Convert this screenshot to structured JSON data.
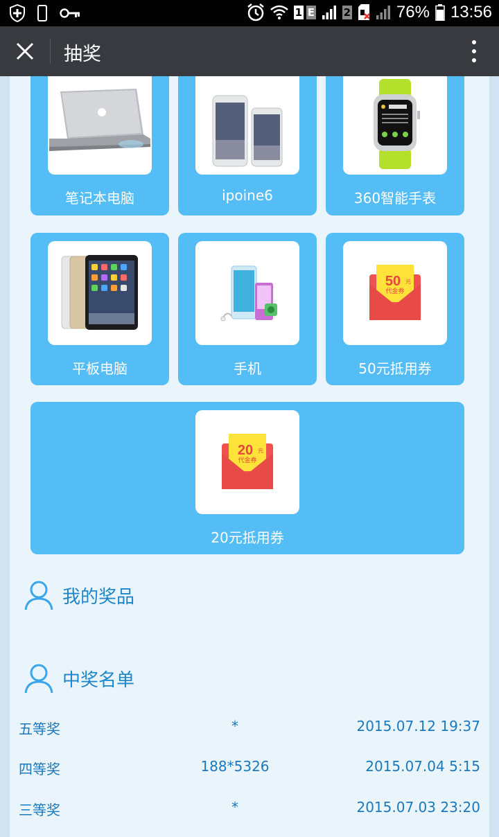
{
  "status_bar": {
    "battery_percent": "76%",
    "time": "13:56",
    "sim1": "1",
    "network": "E",
    "sim2": "2",
    "icons": [
      "shield-plus-icon",
      "phone-outline-icon",
      "key-icon",
      "alarm-icon",
      "wifi-icon",
      "signal-icon",
      "sim-card-icon",
      "signal-icon",
      "battery-icon"
    ]
  },
  "title_bar": {
    "title": "抽奖",
    "close_icon": "close-icon",
    "more_icon": "more-vertical-icon"
  },
  "prizes": [
    {
      "label": "笔记本电脑",
      "image": "laptop"
    },
    {
      "label": "ipoine6",
      "image": "phones"
    },
    {
      "label": "360智能手表",
      "image": "smartwatch"
    },
    {
      "label": "平板电脑",
      "image": "tablets"
    },
    {
      "label": "手机",
      "image": "music-players"
    },
    {
      "label": "50元抵用券",
      "image": "voucher",
      "voucher_value": "50",
      "voucher_unit": "元",
      "voucher_text": "代金券"
    },
    {
      "label": "20元抵用券",
      "image": "voucher",
      "voucher_value": "20",
      "voucher_unit": "元",
      "voucher_text": "代金券"
    }
  ],
  "sections": {
    "my_prizes": "我的奖品",
    "winners": "中奖名单"
  },
  "winners": [
    {
      "prize": "五等奖",
      "user": "*",
      "time": "2015.07.12 19:37"
    },
    {
      "prize": "四等奖",
      "user": "188*5326",
      "time": "2015.07.04 5:15"
    },
    {
      "prize": "三等奖",
      "user": "*",
      "time": "2015.07.03 23:20"
    }
  ],
  "colors": {
    "card_blue": "#55bdf6",
    "title_bar": "#393a3f",
    "text_blue": "#1a79bd",
    "page_bg": "#eaf4fb",
    "voucher_red": "#f0524f",
    "voucher_yellow": "#ffe33b"
  }
}
